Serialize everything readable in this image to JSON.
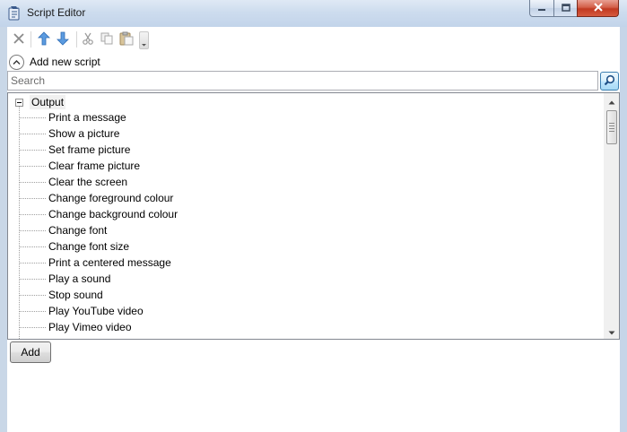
{
  "window": {
    "title": "Script Editor",
    "icons": {
      "app": "script-app-icon",
      "minimize": "minimize-icon",
      "maximize": "maximize-icon",
      "close": "close-icon"
    }
  },
  "toolbar": {
    "buttons": [
      {
        "name": "delete",
        "icon": "x-icon"
      },
      {
        "name": "move-up",
        "icon": "arrow-up-icon"
      },
      {
        "name": "move-down",
        "icon": "arrow-down-icon"
      },
      {
        "name": "cut",
        "icon": "scissors-icon"
      },
      {
        "name": "copy",
        "icon": "copy-icon"
      },
      {
        "name": "paste",
        "icon": "paste-icon"
      }
    ]
  },
  "add_new": {
    "label": "Add new script"
  },
  "search": {
    "placeholder": "Search",
    "value": ""
  },
  "tree": {
    "root_label": "Output",
    "items": [
      "Print a message",
      "Show a picture",
      "Set frame picture",
      "Clear frame picture",
      "Clear the screen",
      "Change foreground colour",
      "Change background colour",
      "Change font",
      "Change font size",
      "Print a centered message",
      "Play a sound",
      "Stop sound",
      "Play YouTube video",
      "Play Vimeo video"
    ]
  },
  "add_button": {
    "label": "Add"
  },
  "colors": {
    "accent": "#3c7fb1",
    "arrow_blue": "#4a8fd8",
    "close_red": "#c13a21"
  }
}
